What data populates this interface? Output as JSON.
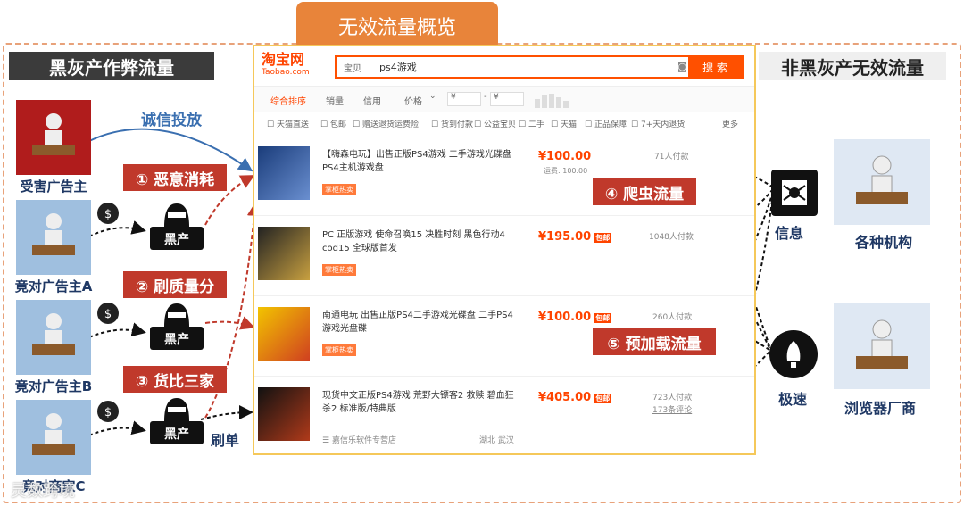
{
  "title": "无效流量概览",
  "left_section": "黑灰产作弊流量",
  "right_section": "非黑灰产无效流量",
  "left_nodes": {
    "victim": "受害广告主",
    "comp_a": "竟对广告主A",
    "comp_b": "竟对广告主B",
    "comp_c": "竟对商家C"
  },
  "hacker_label": "黑产",
  "honest_label": "诚信投放",
  "brush_label": "刷单",
  "fraud_types": [
    "① 恶意消耗",
    "② 刷质量分",
    "③ 货比三家"
  ],
  "invalid_types": [
    "④ 爬虫流量",
    "⑤ 预加载流量"
  ],
  "right_nodes": {
    "info": "信息",
    "speed": "极速",
    "institutions": "各种机构",
    "browser": "浏览器厂商"
  },
  "taobao": {
    "logo": "淘宝网",
    "logo_sub": "Taobao.com",
    "search_scope": "宝贝",
    "search_value": "ps4游戏",
    "search_button": "搜 索",
    "sort_tabs": [
      "综合排序",
      "销量",
      "信用",
      "价格"
    ],
    "price_from": "¥",
    "price_to": "¥",
    "filters": [
      "天猫直送",
      "包邮",
      "赠送退货运费险",
      "货到付款",
      "公益宝贝",
      "二手",
      "天猫",
      "正品保障",
      "7+天内退货"
    ],
    "more": "更多",
    "items": [
      {
        "title": "【嗨森电玩】出售正版PS4游戏 二手游戏光碟盘 PS4主机游戏盘",
        "price": "¥100.00",
        "ship": "运费: 100.00",
        "paid": "71人付款",
        "tag": "掌柜热卖"
      },
      {
        "title": "PC 正版游戏 使命召唤15 决胜时刻 黑色行动4 cod15 全球版首发",
        "price": "¥195.00",
        "ship": "包邮",
        "paid": "1048人付款",
        "tag": "掌柜热卖"
      },
      {
        "title": "南通电玩 出售正版PS4二手游戏光碟盘 二手PS4游戏光盘碟",
        "price": "¥100.00",
        "ship": "包邮",
        "paid": "260人付款",
        "tag": "掌柜热卖"
      },
      {
        "title": "现货中文正版PS4游戏 荒野大镖客2 救赎 碧血狂杀2 标准版/特典版",
        "price": "¥405.00",
        "ship": "包邮",
        "paid": "723人付款",
        "reviews": "173条评论",
        "shop": "嘉信乐软件专营店",
        "location": "湖北 武汉"
      }
    ]
  },
  "watermark": "灵数跨境",
  "colors": {
    "accent": "#e8843a",
    "red": "#c0392b",
    "navy": "#1f3864",
    "taobao": "#ff5000",
    "blue_arrow": "#3a6fb0"
  }
}
